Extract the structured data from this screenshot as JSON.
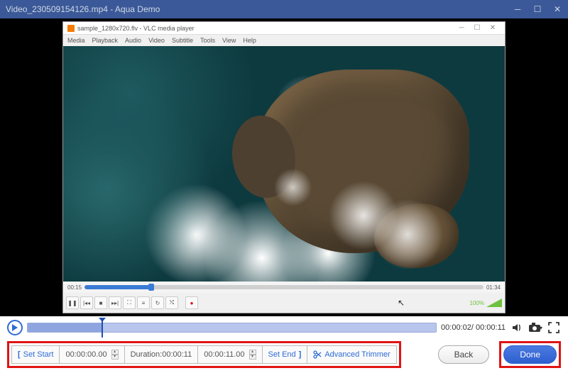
{
  "window": {
    "title": "Video_230509154126.mp4  -  Aqua Demo"
  },
  "vlc": {
    "title": "sample_1280x720.flv - VLC media player",
    "menu": [
      "Media",
      "Playback",
      "Audio",
      "Video",
      "Subtitle",
      "Tools",
      "View",
      "Help"
    ],
    "time_current": "00:15",
    "time_total": "01:34",
    "volume_pct": "100%"
  },
  "playback": {
    "current": "00:00:02",
    "total": "00:00:11"
  },
  "trim": {
    "set_start_label": "Set Start",
    "start_value": "00:00:00.00",
    "duration_label": "Duration:00:00:11",
    "end_value": "00:00:11.00",
    "set_end_label": "Set End",
    "advanced_label": "Advanced Trimmer"
  },
  "buttons": {
    "back": "Back",
    "done": "Done"
  }
}
